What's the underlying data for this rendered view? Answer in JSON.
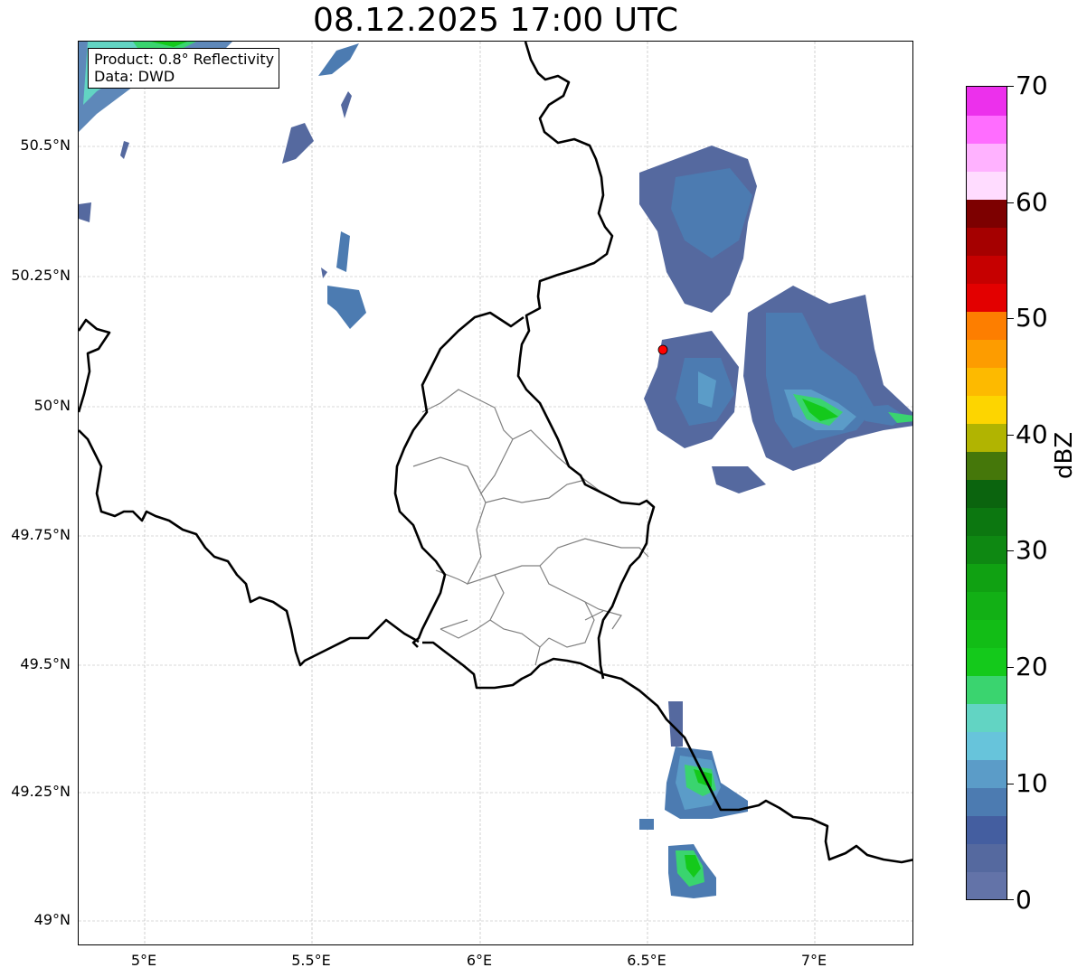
{
  "title": "08.12.2025 17:00 UTC",
  "info": {
    "product": "Product: 0.8° Reflectivity",
    "data": "Data: DWD"
  },
  "lat_ticks": [
    "50.5°N",
    "50.25°N",
    "50°N",
    "49.75°N",
    "49.5°N",
    "49.25°N",
    "49°N"
  ],
  "lon_ticks": [
    "5°E",
    "5.5°E",
    "6°E",
    "6.5°E",
    "7°E"
  ],
  "colorbar": {
    "label": "dBZ",
    "tick_labels": [
      "0",
      "10",
      "20",
      "30",
      "40",
      "50",
      "60",
      "70"
    ],
    "range": [
      0,
      70
    ],
    "colors": [
      "#6373a8",
      "#55699f",
      "#445ea0",
      "#4c7bb1",
      "#5b9cc8",
      "#67c4db",
      "#62d4c3",
      "#3ad46f",
      "#14c91b",
      "#12bd16",
      "#12b015",
      "#10a112",
      "#0e8812",
      "#0c7710",
      "#0b640e",
      "#45770a",
      "#b1b401",
      "#fdd500",
      "#fdba00",
      "#fd9c00",
      "#fd7e00",
      "#e30000",
      "#c60000",
      "#a50000",
      "#7d0000",
      "#ffdcff",
      "#ffb2ff",
      "#ff6dff",
      "#ec30ec"
    ]
  },
  "radar_marker_color": "#ff0000",
  "map": {
    "lon_range": [
      4.8,
      7.3
    ],
    "lat_range": [
      48.95,
      50.7
    ]
  }
}
